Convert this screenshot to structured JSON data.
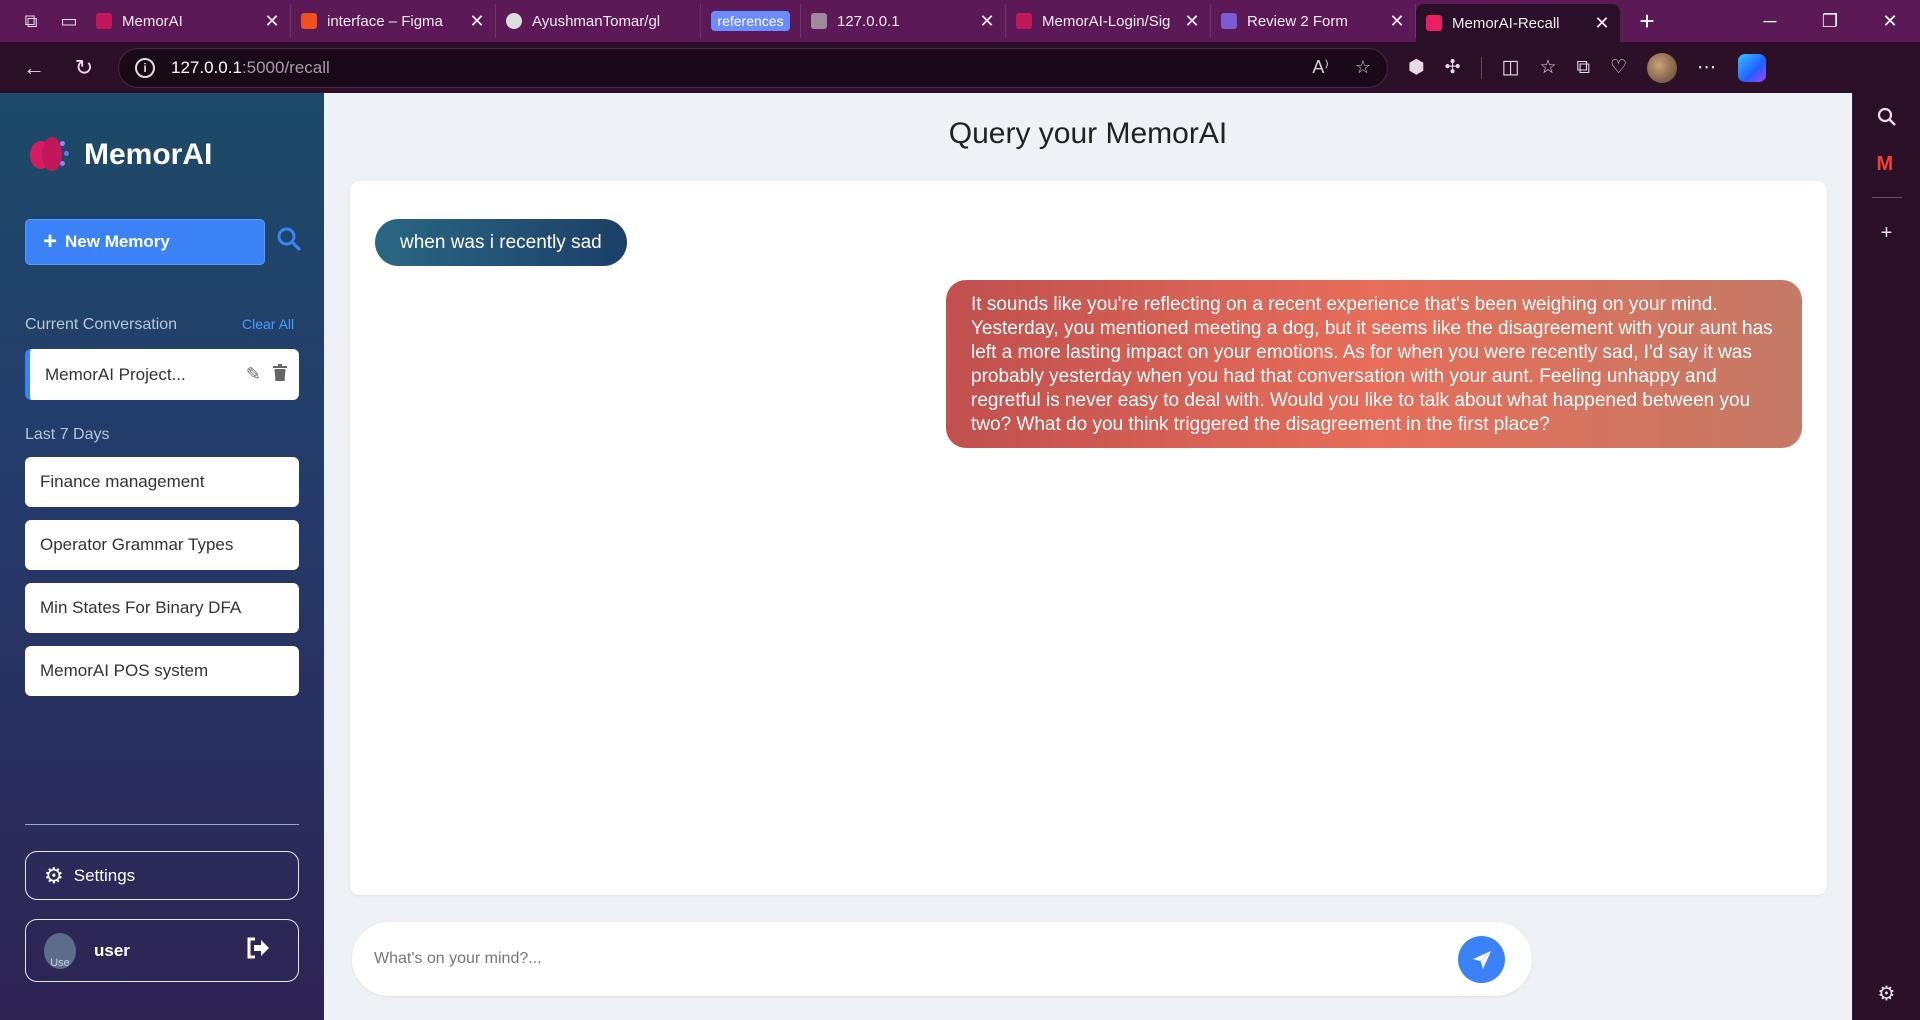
{
  "browser": {
    "tabs": [
      {
        "label": "MemorAI",
        "fav_color": "#c2185b"
      },
      {
        "label": "interface – Figma",
        "fav_color": "#f24e1e"
      },
      {
        "label": "AyushmanTomar/gl",
        "fav_color": "#dddddd"
      },
      {
        "label": "references",
        "fav_color": ""
      },
      {
        "label": "127.0.0.1",
        "fav_color": "#9e8a9c"
      },
      {
        "label": "MemorAI-Login/Sig",
        "fav_color": "#c2185b"
      },
      {
        "label": "Review 2 Form",
        "fav_color": "#7b5cd6"
      },
      {
        "label": "MemorAI-Recall",
        "fav_color": "#e91e63"
      }
    ],
    "url_host": "127.0.0.1",
    "url_path": ":5000/recall"
  },
  "sidebar": {
    "brand": "MemorAI",
    "new_memory": "New Memory",
    "current_label": "Current Conversation",
    "clear_all": "Clear All",
    "current_item": "MemorAI Project...",
    "recent_label": "Last 7 Days",
    "recent_items": [
      {
        "label": "Finance management"
      },
      {
        "label": "Operator Grammar Types"
      },
      {
        "label": "Min States For Binary DFA"
      },
      {
        "label": "MemorAI POS system"
      }
    ],
    "settings": "Settings",
    "avatar_alt": "Use",
    "user": "user"
  },
  "main": {
    "title": "Query your MemorAI",
    "user_message": "when was i recently sad",
    "bot_message": "It sounds like you're reflecting on a recent experience that's been weighing on your mind. Yesterday, you mentioned meeting a dog, but it seems like the disagreement with your aunt has left a more lasting impact on your emotions. As for when you were recently sad, I'd say it was probably yesterday when you had that conversation with your aunt. Feeling unhappy and regretful is never easy to deal with. Would you like to talk about what happened between you two? What do you think triggered the disagreement in the first place?",
    "input_placeholder": "What's on your mind?..."
  },
  "colors": {
    "accent": "#3b82f6",
    "user_bubble": "#1c3f68",
    "bot_bubble": "#e66e5a"
  }
}
